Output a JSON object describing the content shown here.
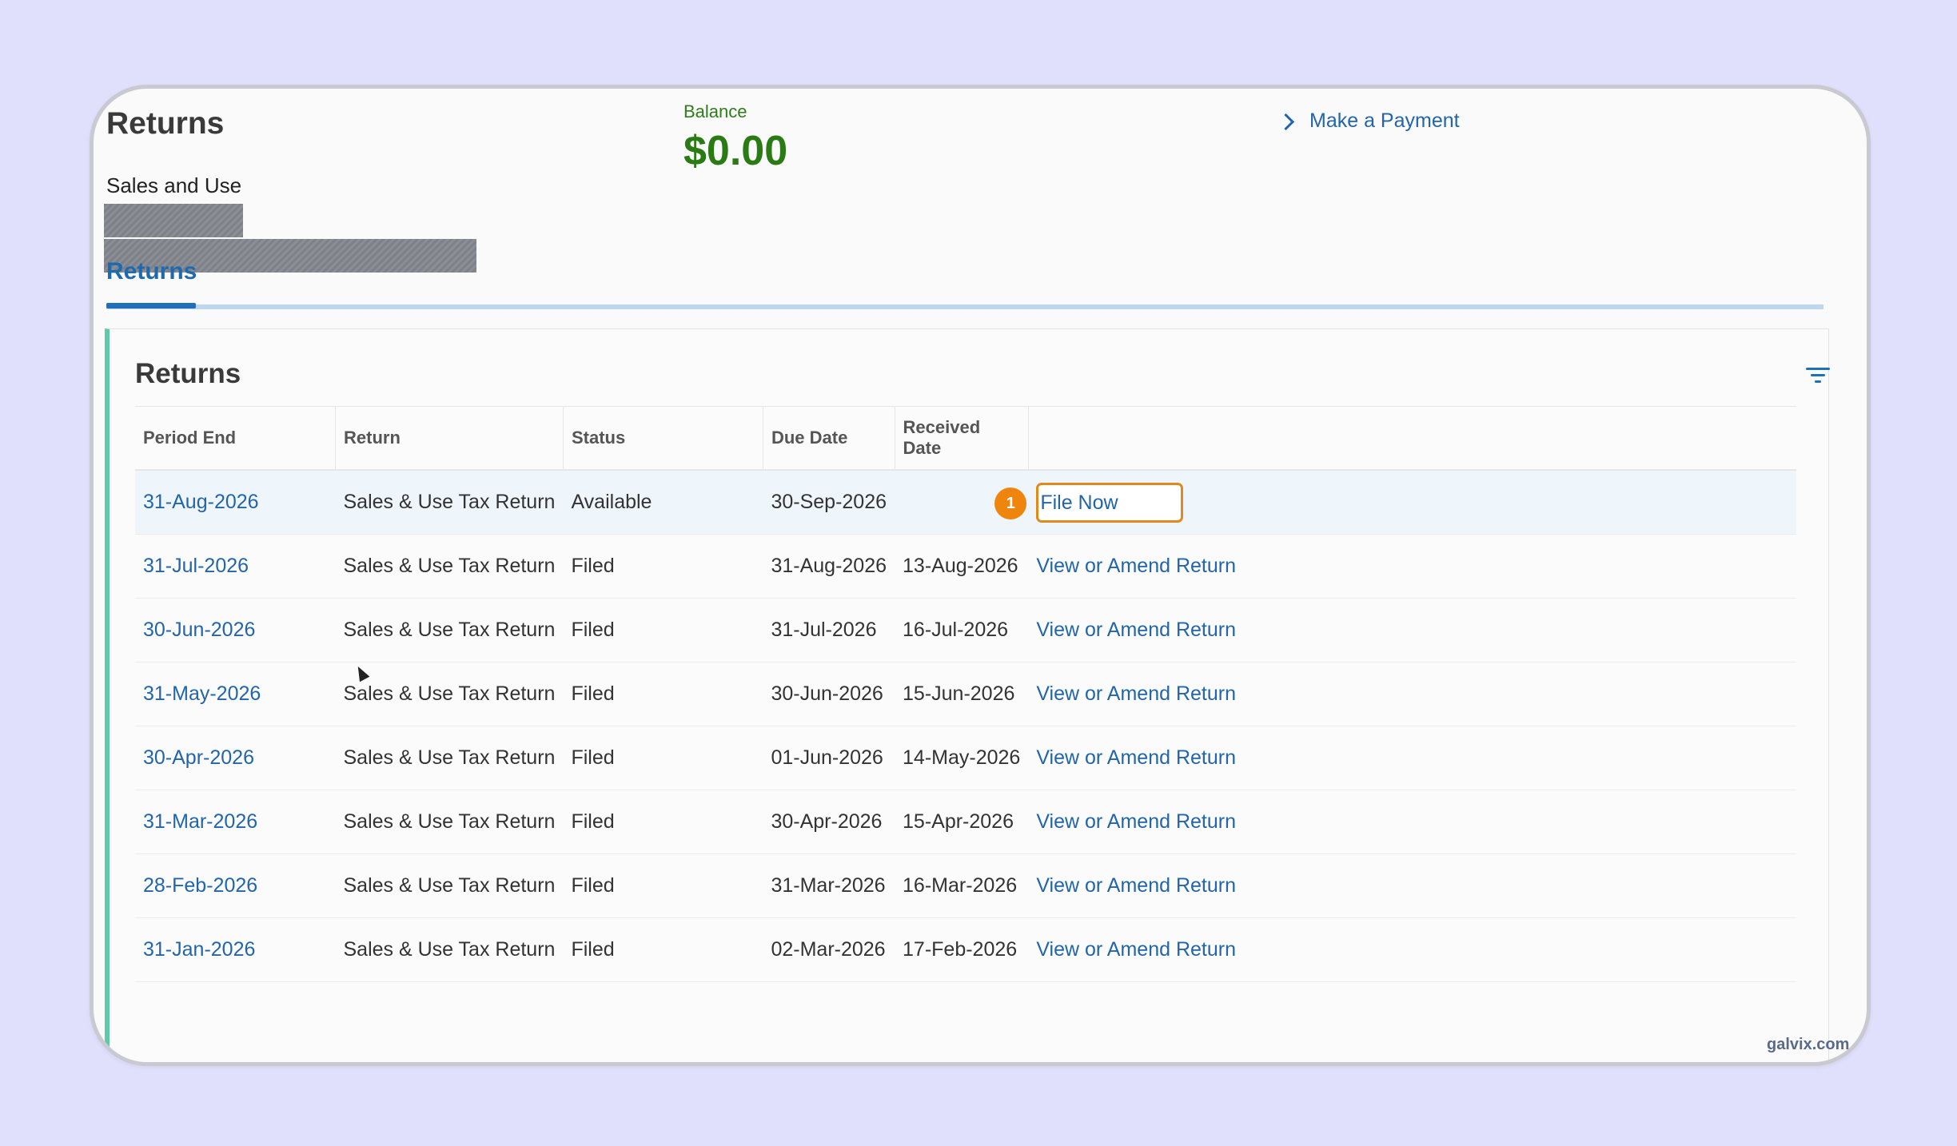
{
  "header": {
    "title": "Returns",
    "account_type": "Sales and Use",
    "balance_label": "Balance",
    "balance_value": "$0.00",
    "payment_link": "Make a Payment"
  },
  "tabs": [
    {
      "label": "Returns",
      "active": true
    }
  ],
  "panel": {
    "title": "Returns",
    "filter_icon": "filter-icon"
  },
  "table": {
    "columns": [
      "Period End",
      "Return",
      "Status",
      "Due Date",
      "Received Date",
      ""
    ],
    "rows": [
      {
        "period_end": "31-Aug-2026",
        "return": "Sales & Use Tax Return",
        "status": "Available",
        "due_date": "30-Sep-2026",
        "received_date": "",
        "action": "File Now"
      },
      {
        "period_end": "31-Jul-2026",
        "return": "Sales & Use Tax Return",
        "status": "Filed",
        "due_date": "31-Aug-2026",
        "received_date": "13-Aug-2026",
        "action": "View or Amend Return"
      },
      {
        "period_end": "30-Jun-2026",
        "return": "Sales & Use Tax Return",
        "status": "Filed",
        "due_date": "31-Jul-2026",
        "received_date": "16-Jul-2026",
        "action": "View or Amend Return"
      },
      {
        "period_end": "31-May-2026",
        "return": "Sales & Use Tax Return",
        "status": "Filed",
        "due_date": "30-Jun-2026",
        "received_date": "15-Jun-2026",
        "action": "View or Amend Return"
      },
      {
        "period_end": "30-Apr-2026",
        "return": "Sales & Use Tax Return",
        "status": "Filed",
        "due_date": "01-Jun-2026",
        "received_date": "14-May-2026",
        "action": "View or Amend Return"
      },
      {
        "period_end": "31-Mar-2026",
        "return": "Sales & Use Tax Return",
        "status": "Filed",
        "due_date": "30-Apr-2026",
        "received_date": "15-Apr-2026",
        "action": "View or Amend Return"
      },
      {
        "period_end": "28-Feb-2026",
        "return": "Sales & Use Tax Return",
        "status": "Filed",
        "due_date": "31-Mar-2026",
        "received_date": "16-Mar-2026",
        "action": "View or Amend Return"
      },
      {
        "period_end": "31-Jan-2026",
        "return": "Sales & Use Tax Return",
        "status": "Filed",
        "due_date": "02-Mar-2026",
        "received_date": "17-Feb-2026",
        "action": "View or Amend Return"
      }
    ]
  },
  "annotation": {
    "step_number": "1"
  },
  "watermark": "galvix.com",
  "colors": {
    "background": "#e0e0fc",
    "link": "#2265a8",
    "balance": "#2a7b14",
    "accent_border": "#5fc9a8",
    "highlight": "#e08a1e"
  }
}
